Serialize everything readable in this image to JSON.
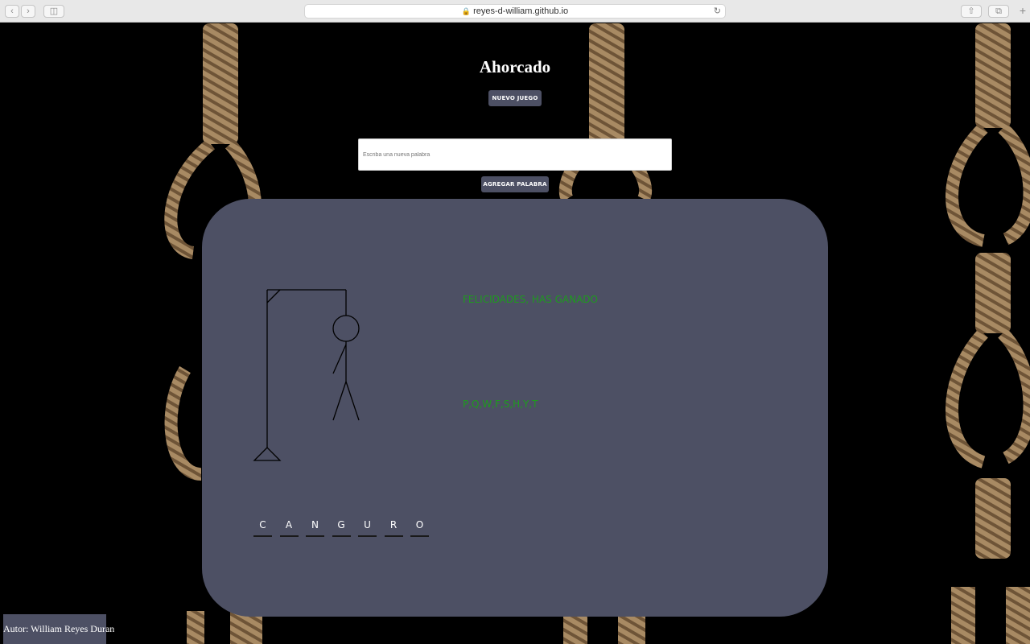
{
  "browser": {
    "url": "reyes-d-william.github.io",
    "back_icon": "chevron-left-icon",
    "forward_icon": "chevron-right-icon"
  },
  "header": {
    "title": "Ahorcado",
    "new_game_label": "NUEVO JUEGO"
  },
  "add_word": {
    "placeholder": "Escriba una nueva palabra",
    "button_label": "AGREGAR PALABRA"
  },
  "game": {
    "status_message": "FELICIDADES, HAS GANADO",
    "wrong_letters": "P,Q,W,F,S,H,Y,T",
    "word_letters": [
      "C",
      "A",
      "N",
      "G",
      "U",
      "R",
      "O"
    ],
    "status_color": "#1e9a1e",
    "board_color": "#4d5064"
  },
  "footer": {
    "author": "Autor: William Reyes Duran"
  }
}
